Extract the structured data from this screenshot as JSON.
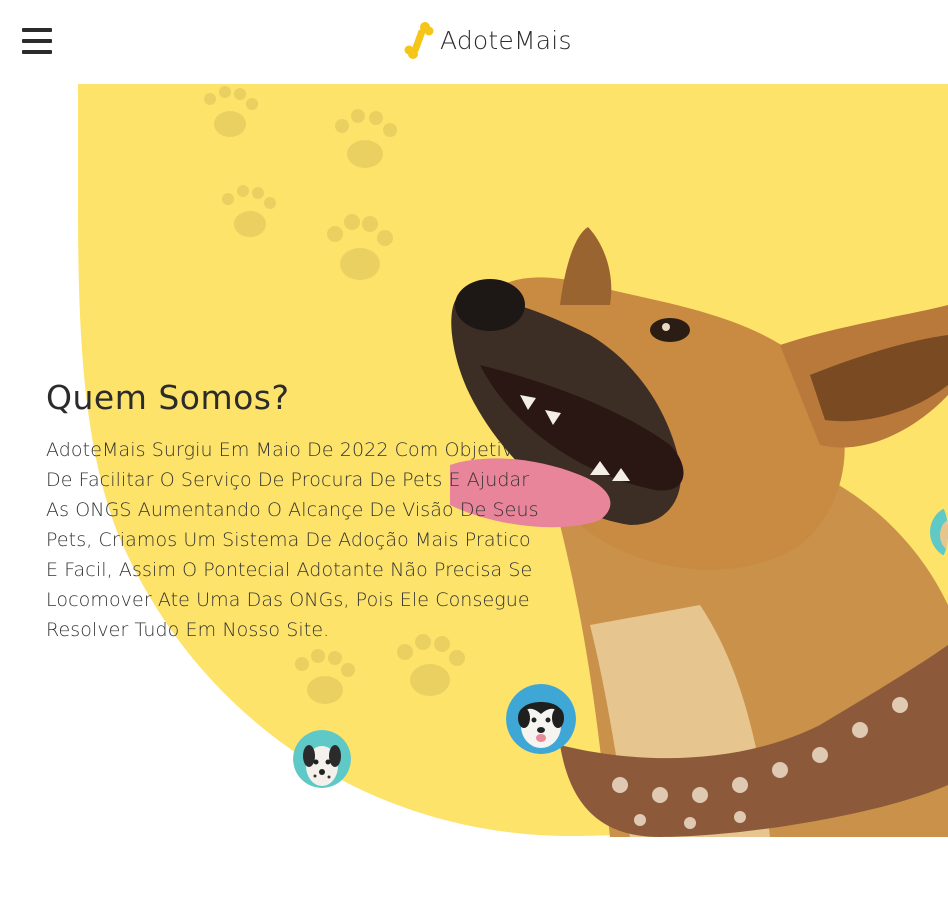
{
  "header": {
    "brand_name": "AdoteMais",
    "menu_icon": "hamburger-menu-icon",
    "logo_icon": "bone-icon"
  },
  "about": {
    "title": "Quem Somos?",
    "text": "AdoteMais Surgiu Em Maio De 2022 Com Objetivo De Facilitar O Serviço De Procura De Pets E Ajudar As ONGS Aumentando O Alcançe De Visão De Seus Pets, Criamos Um Sistema De Adoção Mais Pratico E Facil, Assim O Pontecial Adotante Não Precisa Se Locomover Ate Uma Das ONGs, Pois Ele Consegue Resolver Tudo Em Nosso Site."
  },
  "colors": {
    "accent_yellow": "#fde36a",
    "text_dark": "#2b2b2b",
    "logo_yellow": "#f5c518",
    "avatar_teal": "#5ec9c6",
    "avatar_blue": "#3fa7d6"
  }
}
